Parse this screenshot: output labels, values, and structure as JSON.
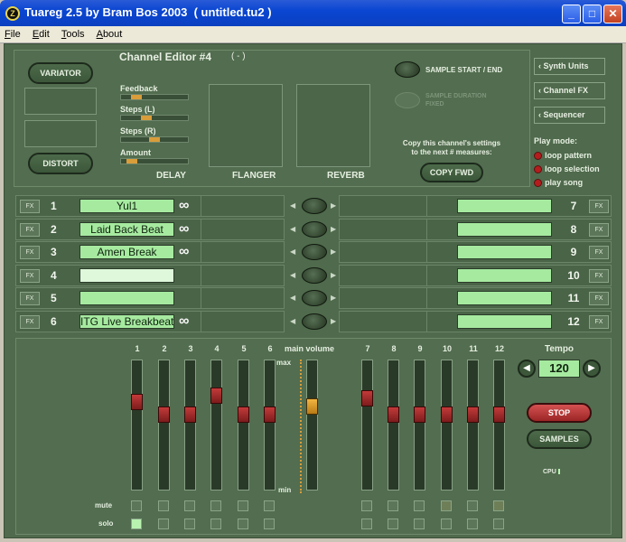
{
  "window": {
    "title": "Tuareg 2.5 by Bram Bos 2003  ( untitled.tu2 )",
    "icon_letter": "Z"
  },
  "menu": [
    {
      "label": "File",
      "key": "F"
    },
    {
      "label": "Edit",
      "key": "E"
    },
    {
      "label": "Tools",
      "key": "T"
    },
    {
      "label": "About",
      "key": "A"
    }
  ],
  "editor": {
    "title": "Channel Editor #4",
    "title_suffix": "( - )",
    "variator": "VARIATOR",
    "distort": "DISTORT",
    "delay_params": [
      {
        "label": "Feedback",
        "level": 0.18
      },
      {
        "label": "Steps (L)",
        "level": 0.35
      },
      {
        "label": "Steps (R)",
        "level": 0.5
      },
      {
        "label": "Amount",
        "level": 0.1
      }
    ],
    "fx_labels": {
      "delay": "DELAY",
      "flanger": "FLANGER",
      "reverb": "REVERB"
    },
    "sample_start_end": "SAMPLE START / END",
    "sample_duration": "SAMPLE DURATION FIXED",
    "copy_text_1": "Copy this channel's settings",
    "copy_text_2": "to the next # measures:",
    "copy_fwd": "COPY FWD"
  },
  "side": {
    "buttons": [
      "Synth Units",
      "Channel FX",
      "Sequencer"
    ],
    "play_mode_title": "Play mode:",
    "play_modes": [
      "loop pattern",
      "loop selection",
      "play song"
    ]
  },
  "channels_left": [
    {
      "n": "1",
      "name": "Yul1",
      "loop": true
    },
    {
      "n": "2",
      "name": "Laid Back Beat",
      "loop": true
    },
    {
      "n": "3",
      "name": "Amen Break",
      "loop": true
    },
    {
      "n": "4",
      "name": "",
      "loop": false,
      "empty": true
    },
    {
      "n": "5",
      "name": "",
      "loop": false
    },
    {
      "n": "6",
      "name": "ITG Live Breakbeat",
      "loop": true
    }
  ],
  "channels_right": [
    {
      "n": "7"
    },
    {
      "n": "8"
    },
    {
      "n": "9"
    },
    {
      "n": "10"
    },
    {
      "n": "11"
    },
    {
      "n": "12"
    }
  ],
  "fx_button": "FX",
  "mixer": {
    "main_volume_label": "main volume",
    "max_label": "max",
    "min_label": "min",
    "mute_label": "mute",
    "solo_label": "solo",
    "channels": [
      {
        "n": "1",
        "level": 0.71,
        "mute": false,
        "solo": true
      },
      {
        "n": "2",
        "level": 0.6,
        "mute": false,
        "solo": false
      },
      {
        "n": "3",
        "level": 0.6,
        "mute": false,
        "solo": false
      },
      {
        "n": "4",
        "level": 0.76,
        "mute": false,
        "solo": false
      },
      {
        "n": "5",
        "level": 0.6,
        "mute": false,
        "solo": false
      },
      {
        "n": "6",
        "level": 0.6,
        "mute": false,
        "solo": false
      },
      {
        "n": "7",
        "level": 0.74,
        "mute": false,
        "solo": false
      },
      {
        "n": "8",
        "level": 0.6,
        "mute": false,
        "solo": false
      },
      {
        "n": "9",
        "level": 0.6,
        "mute": false,
        "solo": false
      },
      {
        "n": "10",
        "level": 0.6,
        "mute": true,
        "solo": false
      },
      {
        "n": "11",
        "level": 0.6,
        "mute": false,
        "solo": false
      },
      {
        "n": "12",
        "level": 0.6,
        "mute": true,
        "solo": false
      }
    ],
    "main_volume_level": 0.67
  },
  "tempo": {
    "label": "Tempo",
    "value": "120"
  },
  "transport": {
    "stop": "STOP",
    "samples": "SAMPLES",
    "cpu": "CPU"
  },
  "colors": {
    "accent_green": "#a6eaa0",
    "led_red": "#b41d1d",
    "knob_orange": "#d99d3a",
    "fader_red": "#c33a3a"
  }
}
